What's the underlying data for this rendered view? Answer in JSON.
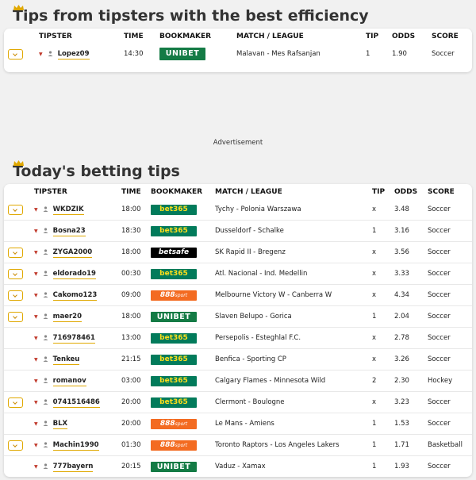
{
  "section1": {
    "title": "Tips from tipsters with the best efficiency",
    "headers": {
      "tipster": "TIPSTER",
      "time": "TIME",
      "bookmaker": "BOOKMAKER",
      "match": "MATCH / LEAGUE",
      "tip": "TIP",
      "odds": "ODDS",
      "score": "SCORE"
    },
    "rows": [
      {
        "tipster": "Lopez09",
        "time": "14:30",
        "bookmaker": "UNIBET",
        "bookmaker_type": "unibet",
        "match": "Malavan - Mes Rafsanjan",
        "tip": "1",
        "odds": "1.90",
        "score": "Soccer",
        "expandable": true
      }
    ]
  },
  "advertisement": "Advertisement",
  "section2": {
    "title": "Today's betting tips",
    "headers": {
      "tipster": "TIPSTER",
      "time": "TIME",
      "bookmaker": "BOOKMAKER",
      "match": "MATCH / LEAGUE",
      "tip": "TIP",
      "odds": "ODDS",
      "score": "SCORE"
    },
    "rows": [
      {
        "tipster": "WKDZIK",
        "time": "18:00",
        "bookmaker": "bet365",
        "bookmaker_type": "bet365",
        "match": "Tychy - Polonia Warszawa",
        "tip": "x",
        "odds": "3.48",
        "score": "Soccer",
        "expandable": true
      },
      {
        "tipster": "Bosna23",
        "time": "18:30",
        "bookmaker": "bet365",
        "bookmaker_type": "bet365",
        "match": "Dusseldorf - Schalke",
        "tip": "1",
        "odds": "3.16",
        "score": "Soccer",
        "expandable": false
      },
      {
        "tipster": "ZYGA2000",
        "time": "18:00",
        "bookmaker": "betsafe",
        "bookmaker_type": "betsafe",
        "match": "SK Rapid II - Bregenz",
        "tip": "x",
        "odds": "3.56",
        "score": "Soccer",
        "expandable": true
      },
      {
        "tipster": "eldorado19",
        "time": "00:30",
        "bookmaker": "bet365",
        "bookmaker_type": "bet365",
        "match": "Atl. Nacional - Ind. Medellin",
        "tip": "x",
        "odds": "3.33",
        "score": "Soccer",
        "expandable": true
      },
      {
        "tipster": "Cakomo123",
        "time": "09:00",
        "bookmaker": "888",
        "bookmaker_type": "888",
        "match": "Melbourne Victory W - Canberra W",
        "tip": "x",
        "odds": "4.34",
        "score": "Soccer",
        "expandable": true
      },
      {
        "tipster": "maer20",
        "time": "18:00",
        "bookmaker": "UNIBET",
        "bookmaker_type": "unibet",
        "match": "Slaven Belupo - Gorica",
        "tip": "1",
        "odds": "2.04",
        "score": "Soccer",
        "expandable": true
      },
      {
        "tipster": "716978461",
        "time": "13:00",
        "bookmaker": "bet365",
        "bookmaker_type": "bet365",
        "match": "Persepolis - Esteghlal F.C.",
        "tip": "x",
        "odds": "2.78",
        "score": "Soccer",
        "expandable": false
      },
      {
        "tipster": "Tenkeu",
        "time": "21:15",
        "bookmaker": "bet365",
        "bookmaker_type": "bet365",
        "match": "Benfica - Sporting CP",
        "tip": "x",
        "odds": "3.26",
        "score": "Soccer",
        "expandable": false
      },
      {
        "tipster": "romanov",
        "time": "03:00",
        "bookmaker": "bet365",
        "bookmaker_type": "bet365",
        "match": "Calgary Flames - Minnesota Wild",
        "tip": "2",
        "odds": "2.30",
        "score": "Hockey",
        "expandable": false
      },
      {
        "tipster": "0741516486",
        "time": "20:00",
        "bookmaker": "bet365",
        "bookmaker_type": "bet365",
        "match": "Clermont - Boulogne",
        "tip": "x",
        "odds": "3.23",
        "score": "Soccer",
        "expandable": true
      },
      {
        "tipster": "BLX",
        "time": "20:00",
        "bookmaker": "888",
        "bookmaker_type": "888",
        "match": "Le Mans - Amiens",
        "tip": "1",
        "odds": "1.53",
        "score": "Soccer",
        "expandable": false
      },
      {
        "tipster": "Machin1990",
        "time": "01:30",
        "bookmaker": "888",
        "bookmaker_type": "888",
        "match": "Toronto Raptors - Los Angeles Lakers",
        "tip": "1",
        "odds": "1.71",
        "score": "Basketball",
        "expandable": true
      },
      {
        "tipster": "777bayern",
        "time": "20:15",
        "bookmaker": "UNIBET",
        "bookmaker_type": "unibet",
        "match": "Vaduz - Xamax",
        "tip": "1",
        "odds": "1.93",
        "score": "Soccer",
        "expandable": false
      }
    ]
  },
  "colors": {
    "accent": "#e0a800",
    "unibet": "#147b45",
    "bet365": "#027b5b",
    "bet365_text": "#ffdf1b",
    "betsafe": "#000000",
    "b888": "#f36b21",
    "arrow": "#c0392b"
  }
}
